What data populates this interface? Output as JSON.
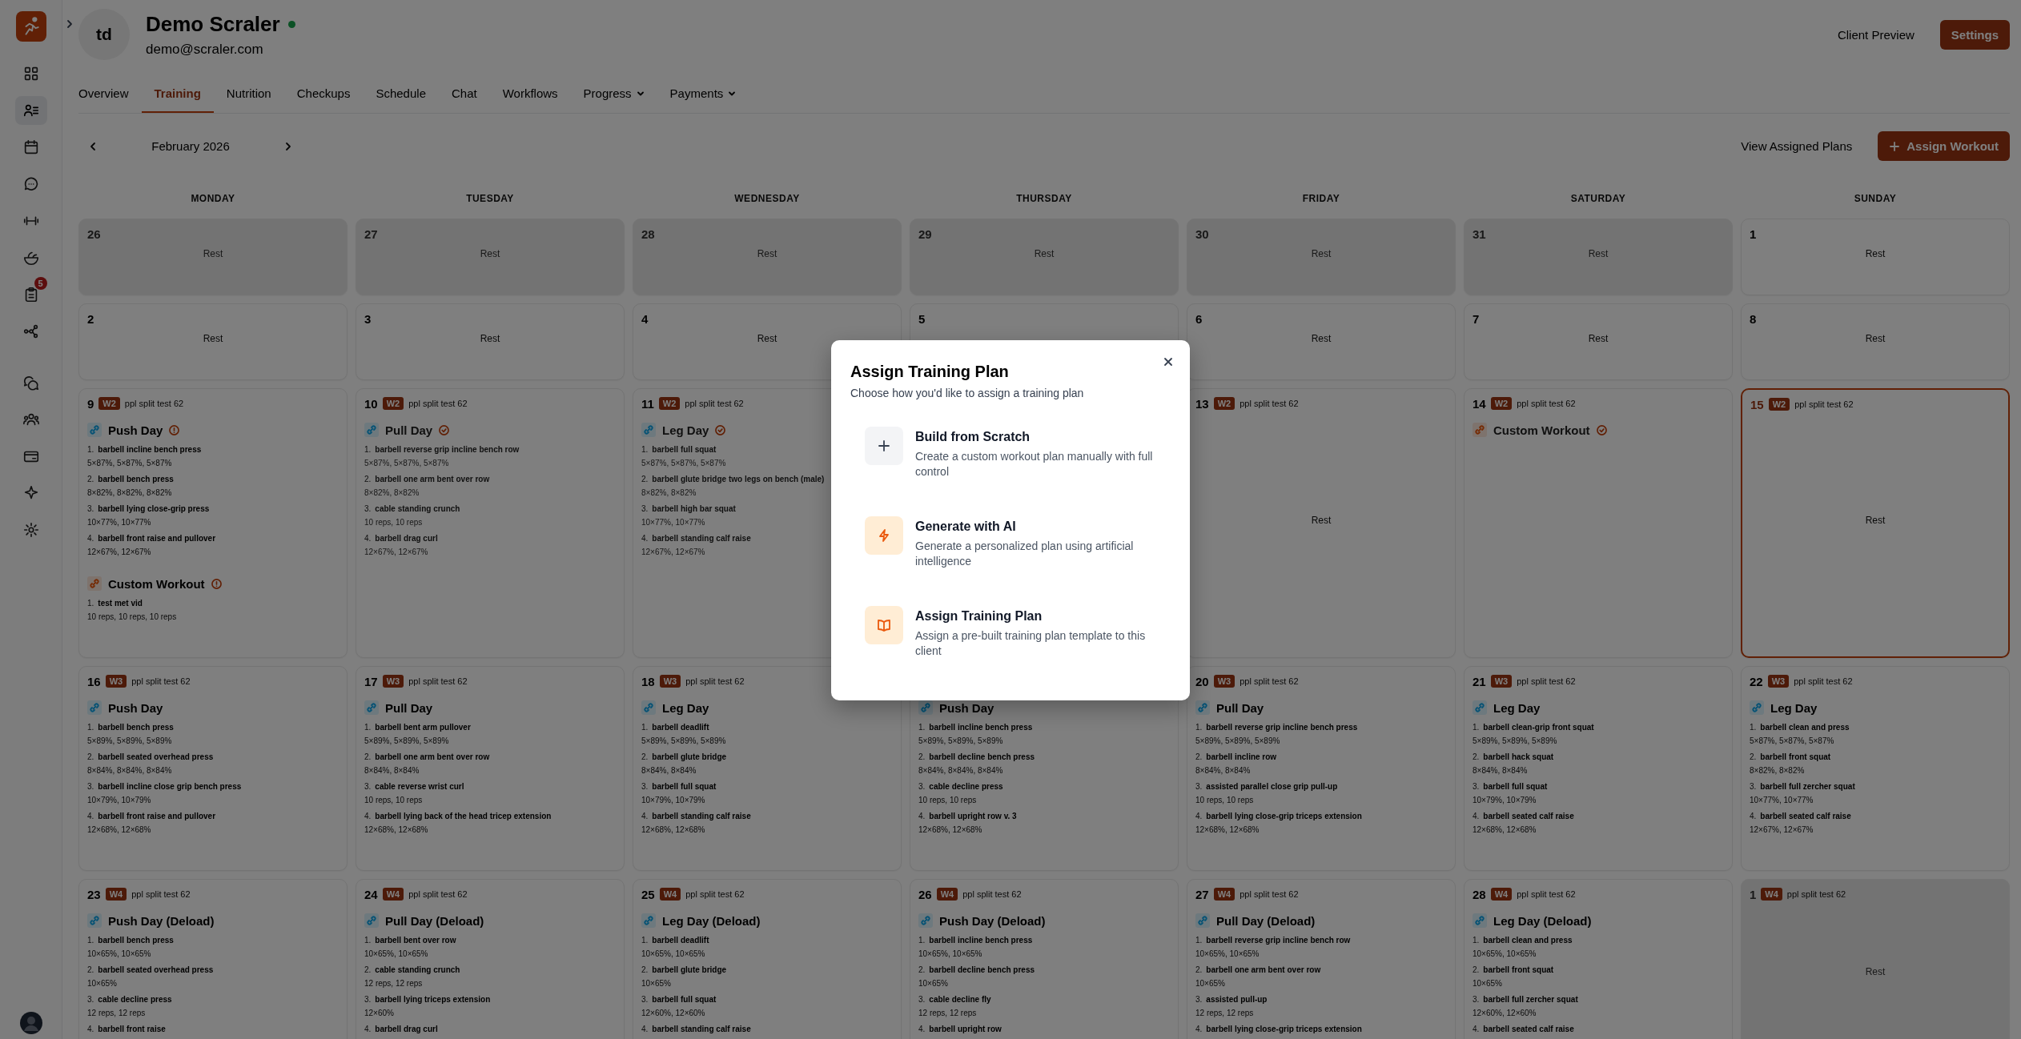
{
  "sidebar": {
    "primary_items": [
      {
        "selected": false
      },
      {
        "selected": true
      },
      {
        "selected": false
      },
      {
        "selected": false
      },
      {
        "selected": false
      },
      {
        "selected": false
      },
      {
        "selected": false,
        "badge": "5"
      },
      {
        "selected": false
      }
    ],
    "secondary_items": [
      {
        "selected": false
      },
      {
        "selected": false
      },
      {
        "selected": false
      },
      {
        "selected": false
      },
      {
        "selected": false
      }
    ]
  },
  "client": {
    "initials": "td",
    "name": "Demo Scraler",
    "online": true,
    "email": "demo@scraler.com"
  },
  "header_actions": {
    "preview": "Client Preview",
    "settings": "Settings"
  },
  "tabs": [
    {
      "label": "Overview",
      "selected": false
    },
    {
      "label": "Training",
      "selected": true
    },
    {
      "label": "Nutrition",
      "selected": false
    },
    {
      "label": "Checkups",
      "selected": false
    },
    {
      "label": "Schedule",
      "selected": false
    },
    {
      "label": "Chat",
      "selected": false
    },
    {
      "label": "Workflows",
      "selected": false
    },
    {
      "label": "Progress",
      "selected": false,
      "has_menu": true
    },
    {
      "label": "Payments",
      "selected": false,
      "has_menu": true
    }
  ],
  "calendar": {
    "month": "February 2026",
    "view_plans": "View Assigned Plans",
    "assign": "Assign Workout",
    "weekdays": [
      "MONDAY",
      "TUESDAY",
      "WEDNESDAY",
      "THURSDAY",
      "FRIDAY",
      "SATURDAY",
      "SUNDAY"
    ],
    "weeks": [
      {
        "days": [
          {
            "date": "26",
            "outside": true,
            "rest": "Rest"
          },
          {
            "date": "27",
            "outside": true,
            "rest": "Rest"
          },
          {
            "date": "28",
            "outside": true,
            "rest": "Rest"
          },
          {
            "date": "29",
            "outside": true,
            "rest": "Rest"
          },
          {
            "date": "30",
            "outside": true,
            "rest": "Rest"
          },
          {
            "date": "31",
            "outside": true,
            "rest": "Rest"
          },
          {
            "date": "1",
            "outside": false,
            "rest": "Rest"
          }
        ]
      },
      {
        "days": [
          {
            "date": "2",
            "outside": false,
            "rest": "Rest"
          },
          {
            "date": "3",
            "outside": false,
            "rest": "Rest"
          },
          {
            "date": "4",
            "outside": false,
            "rest": "Rest"
          },
          {
            "date": "5",
            "outside": false
          },
          {
            "date": "6",
            "outside": false,
            "rest": "Rest"
          },
          {
            "date": "7",
            "outside": false,
            "rest": "Rest"
          },
          {
            "date": "8",
            "outside": false,
            "rest": "Rest"
          }
        ]
      },
      {
        "days": [
          {
            "date": "9",
            "outside": false,
            "week": "W2",
            "plan": "ppl split test 62",
            "workouts": [
              {
                "title": "Push Day",
                "kind": "plan",
                "completed": false,
                "exercises": [
                  {
                    "number": "1.",
                    "name": "barbell incline bench press",
                    "sets": "5×87%, 5×87%, 5×87%"
                  },
                  {
                    "number": "2.",
                    "name": "barbell bench press",
                    "sets": "8×82%, 8×82%, 8×82%"
                  },
                  {
                    "number": "3.",
                    "name": "barbell lying close-grip press",
                    "sets": "10×77%, 10×77%"
                  },
                  {
                    "number": "4.",
                    "name": "barbell front raise and pullover",
                    "sets": "12×67%, 12×67%"
                  }
                ]
              },
              {
                "title": "Custom Workout",
                "kind": "custom",
                "completed": false,
                "exercises": [
                  {
                    "number": "1.",
                    "name": "test met vid",
                    "sets": "10 reps, 10 reps, 10 reps"
                  }
                ]
              }
            ]
          },
          {
            "date": "10",
            "outside": false,
            "week": "W2",
            "plan": "ppl split test 62",
            "workouts": [
              {
                "title": "Pull Day",
                "kind": "plan",
                "completed": true,
                "exercises": [
                  {
                    "number": "1.",
                    "name": "barbell reverse grip incline bench row",
                    "sets": "5×87%, 5×87%, 5×87%"
                  },
                  {
                    "number": "2.",
                    "name": "barbell one arm bent over row",
                    "sets": "8×82%, 8×82%"
                  },
                  {
                    "number": "3.",
                    "name": "cable standing crunch",
                    "sets": "10 reps, 10 reps"
                  },
                  {
                    "number": "4.",
                    "name": "barbell drag curl",
                    "sets": "12×67%, 12×67%"
                  }
                ]
              }
            ]
          },
          {
            "date": "11",
            "outside": false,
            "week": "W2",
            "plan": "ppl split test 62",
            "workouts": [
              {
                "title": "Leg Day",
                "kind": "plan",
                "completed": true,
                "exercises": [
                  {
                    "number": "1.",
                    "name": "barbell full squat",
                    "sets": "5×87%, 5×87%, 5×87%"
                  },
                  {
                    "number": "2.",
                    "name": "barbell glute bridge two legs on bench (male)",
                    "sets": "8×82%, 8×82%"
                  },
                  {
                    "number": "3.",
                    "name": "barbell high bar squat",
                    "sets": "10×77%, 10×77%"
                  },
                  {
                    "number": "4.",
                    "name": "barbell standing calf raise",
                    "sets": "12×67%, 12×67%"
                  }
                ]
              }
            ]
          },
          {
            "date": "13",
            "outside": false,
            "week": "W2",
            "plan": "ppl split test 62",
            "rest": "Rest"
          },
          {
            "date": "14",
            "outside": false,
            "week": "W2",
            "plan": "ppl split test 62",
            "workouts": [
              {
                "title": "Custom Workout",
                "kind": "custom",
                "completed": true
              }
            ]
          },
          {
            "date": "15",
            "outside": false,
            "today": true,
            "week": "W2",
            "plan": "ppl split test 62",
            "rest": "Rest"
          }
        ]
      },
      {
        "days": [
          {
            "date": "16",
            "outside": false,
            "week": "W3",
            "plan": "ppl split test 62",
            "workouts": [
              {
                "title": "Push Day",
                "kind": "plan",
                "exercises": [
                  {
                    "number": "1.",
                    "name": "barbell bench press",
                    "sets": "5×89%, 5×89%, 5×89%"
                  },
                  {
                    "number": "2.",
                    "name": "barbell seated overhead press",
                    "sets": "8×84%, 8×84%, 8×84%"
                  },
                  {
                    "number": "3.",
                    "name": "barbell incline close grip bench press",
                    "sets": "10×79%, 10×79%"
                  },
                  {
                    "number": "4.",
                    "name": "barbell front raise and pullover",
                    "sets": "12×68%, 12×68%"
                  }
                ]
              }
            ]
          },
          {
            "date": "17",
            "outside": false,
            "week": "W3",
            "plan": "ppl split test 62",
            "workouts": [
              {
                "title": "Pull Day",
                "kind": "plan",
                "exercises": [
                  {
                    "number": "1.",
                    "name": "barbell bent arm pullover",
                    "sets": "5×89%, 5×89%, 5×89%"
                  },
                  {
                    "number": "2.",
                    "name": "barbell one arm bent over row",
                    "sets": "8×84%, 8×84%"
                  },
                  {
                    "number": "3.",
                    "name": "cable reverse wrist curl",
                    "sets": "10 reps, 10 reps"
                  },
                  {
                    "number": "4.",
                    "name": "barbell lying back of the head tricep extension",
                    "sets": "12×68%, 12×68%"
                  }
                ]
              }
            ]
          },
          {
            "date": "18",
            "outside": false,
            "week": "W3",
            "plan": "ppl split test 62",
            "workouts": [
              {
                "title": "Leg Day",
                "kind": "plan",
                "exercises": [
                  {
                    "number": "1.",
                    "name": "barbell deadlift",
                    "sets": "5×89%, 5×89%, 5×89%"
                  },
                  {
                    "number": "2.",
                    "name": "barbell glute bridge",
                    "sets": "8×84%, 8×84%"
                  },
                  {
                    "number": "3.",
                    "name": "barbell full squat",
                    "sets": "10×79%, 10×79%"
                  },
                  {
                    "number": "4.",
                    "name": "barbell standing calf raise",
                    "sets": "12×68%, 12×68%"
                  }
                ]
              }
            ]
          },
          {
            "workouts": [
              {
                "title": "Push Day",
                "kind": "plan",
                "exercises": [
                  {
                    "number": "1.",
                    "name": "barbell incline bench press",
                    "sets": "5×89%, 5×89%, 5×89%"
                  },
                  {
                    "number": "2.",
                    "name": "barbell decline bench press",
                    "sets": "8×84%, 8×84%, 8×84%"
                  },
                  {
                    "number": "3.",
                    "name": "cable decline press",
                    "sets": "10 reps, 10 reps"
                  },
                  {
                    "number": "4.",
                    "name": "barbell upright row v. 3",
                    "sets": "12×68%, 12×68%"
                  }
                ]
              }
            ]
          },
          {
            "date": "20",
            "outside": false,
            "week": "W3",
            "plan": "ppl split test 62",
            "workouts": [
              {
                "title": "Pull Day",
                "kind": "plan",
                "exercises": [
                  {
                    "number": "1.",
                    "name": "barbell reverse grip incline bench press",
                    "sets": "5×89%, 5×89%, 5×89%"
                  },
                  {
                    "number": "2.",
                    "name": "barbell incline row",
                    "sets": "8×84%, 8×84%"
                  },
                  {
                    "number": "3.",
                    "name": "assisted parallel close grip pull-up",
                    "sets": "10 reps, 10 reps"
                  },
                  {
                    "number": "4.",
                    "name": "barbell lying close-grip triceps extension",
                    "sets": "12×68%, 12×68%"
                  }
                ]
              }
            ]
          },
          {
            "date": "21",
            "outside": false,
            "week": "W3",
            "plan": "ppl split test 62",
            "workouts": [
              {
                "title": "Leg Day",
                "kind": "plan",
                "exercises": [
                  {
                    "number": "1.",
                    "name": "barbell clean-grip front squat",
                    "sets": "5×89%, 5×89%, 5×89%"
                  },
                  {
                    "number": "2.",
                    "name": "barbell hack squat",
                    "sets": "8×84%, 8×84%"
                  },
                  {
                    "number": "3.",
                    "name": "barbell full squat",
                    "sets": "10×79%, 10×79%"
                  },
                  {
                    "number": "4.",
                    "name": "barbell seated calf raise",
                    "sets": "12×68%, 12×68%"
                  }
                ]
              }
            ]
          },
          {
            "date": "22",
            "outside": false,
            "week": "W3",
            "plan": "ppl split test 62",
            "workouts": [
              {
                "title": "Leg Day",
                "kind": "plan",
                "exercises": [
                  {
                    "number": "1.",
                    "name": "barbell clean and press",
                    "sets": "5×87%, 5×87%, 5×87%"
                  },
                  {
                    "number": "2.",
                    "name": "barbell front squat",
                    "sets": "8×82%, 8×82%"
                  },
                  {
                    "number": "3.",
                    "name": "barbell full zercher squat",
                    "sets": "10×77%, 10×77%"
                  },
                  {
                    "number": "4.",
                    "name": "barbell seated calf raise",
                    "sets": "12×67%, 12×67%"
                  }
                ]
              }
            ]
          }
        ]
      },
      {
        "days": [
          {
            "date": "23",
            "outside": false,
            "week": "W4",
            "plan": "ppl split test 62",
            "workouts": [
              {
                "title": "Push Day (Deload)",
                "kind": "plan",
                "exercises": [
                  {
                    "number": "1.",
                    "name": "barbell bench press",
                    "sets": "10×65%, 10×65%"
                  },
                  {
                    "number": "2.",
                    "name": "barbell seated overhead press",
                    "sets": "10×65%"
                  },
                  {
                    "number": "3.",
                    "name": "cable decline press",
                    "sets": "12 reps, 12 reps"
                  },
                  {
                    "number": "4.",
                    "name": "barbell front raise"
                  }
                ]
              }
            ]
          },
          {
            "date": "24",
            "outside": false,
            "week": "W4",
            "plan": "ppl split test 62",
            "workouts": [
              {
                "title": "Pull Day (Deload)",
                "kind": "plan",
                "exercises": [
                  {
                    "number": "1.",
                    "name": "barbell bent over row",
                    "sets": "10×65%, 10×65%"
                  },
                  {
                    "number": "2.",
                    "name": "cable standing crunch",
                    "sets": "12 reps, 12 reps"
                  },
                  {
                    "number": "3.",
                    "name": "barbell lying triceps extension",
                    "sets": "12×60%"
                  },
                  {
                    "number": "4.",
                    "name": "barbell drag curl"
                  }
                ]
              }
            ]
          },
          {
            "date": "25",
            "outside": false,
            "week": "W4",
            "plan": "ppl split test 62",
            "workouts": [
              {
                "title": "Leg Day (Deload)",
                "kind": "plan",
                "exercises": [
                  {
                    "number": "1.",
                    "name": "barbell deadlift",
                    "sets": "10×65%, 10×65%"
                  },
                  {
                    "number": "2.",
                    "name": "barbell glute bridge",
                    "sets": "10×65%"
                  },
                  {
                    "number": "3.",
                    "name": "barbell full squat",
                    "sets": "12×60%, 12×60%"
                  },
                  {
                    "number": "4.",
                    "name": "barbell standing calf raise"
                  }
                ]
              }
            ]
          },
          {
            "date": "26",
            "outside": false,
            "week": "W4",
            "plan": "ppl split test 62",
            "workouts": [
              {
                "title": "Push Day (Deload)",
                "kind": "plan",
                "exercises": [
                  {
                    "number": "1.",
                    "name": "barbell incline bench press",
                    "sets": "10×65%, 10×65%"
                  },
                  {
                    "number": "2.",
                    "name": "barbell decline bench press",
                    "sets": "10×65%"
                  },
                  {
                    "number": "3.",
                    "name": "cable decline fly",
                    "sets": "12 reps, 12 reps"
                  },
                  {
                    "number": "4.",
                    "name": "barbell upright row"
                  }
                ]
              }
            ]
          },
          {
            "date": "27",
            "outside": false,
            "week": "W4",
            "plan": "ppl split test 62",
            "workouts": [
              {
                "title": "Pull Day (Deload)",
                "kind": "plan",
                "exercises": [
                  {
                    "number": "1.",
                    "name": "barbell reverse grip incline bench row",
                    "sets": "10×65%, 10×65%"
                  },
                  {
                    "number": "2.",
                    "name": "barbell one arm bent over row",
                    "sets": "10×65%"
                  },
                  {
                    "number": "3.",
                    "name": "assisted pull-up",
                    "sets": "12 reps, 12 reps"
                  },
                  {
                    "number": "4.",
                    "name": "barbell lying close-grip triceps extension"
                  }
                ]
              }
            ]
          },
          {
            "date": "28",
            "outside": false,
            "week": "W4",
            "plan": "ppl split test 62",
            "workouts": [
              {
                "title": "Leg Day (Deload)",
                "kind": "plan",
                "exercises": [
                  {
                    "number": "1.",
                    "name": "barbell clean and press",
                    "sets": "10×65%, 10×65%"
                  },
                  {
                    "number": "2.",
                    "name": "barbell front squat",
                    "sets": "10×65%"
                  },
                  {
                    "number": "3.",
                    "name": "barbell full zercher squat",
                    "sets": "12×60%, 12×60%"
                  },
                  {
                    "number": "4.",
                    "name": "barbell seated calf raise"
                  }
                ]
              }
            ]
          },
          {
            "date": "1",
            "outside": true,
            "week": "W4",
            "plan": "ppl split test 62",
            "rest": "Rest"
          }
        ]
      }
    ]
  },
  "dialog": {
    "title": "Assign Training Plan",
    "subtitle": "Choose how you'd like to assign a training plan",
    "options": [
      {
        "kind": "scratch",
        "title": "Build from Scratch",
        "description": "Create a custom workout plan manually with full control"
      },
      {
        "kind": "ai",
        "title": "Generate with AI",
        "description": "Generate a personalized plan using artificial intelligence"
      },
      {
        "kind": "template",
        "title": "Assign Training Plan",
        "description": "Assign a pre-built training plan template to this client"
      }
    ]
  }
}
